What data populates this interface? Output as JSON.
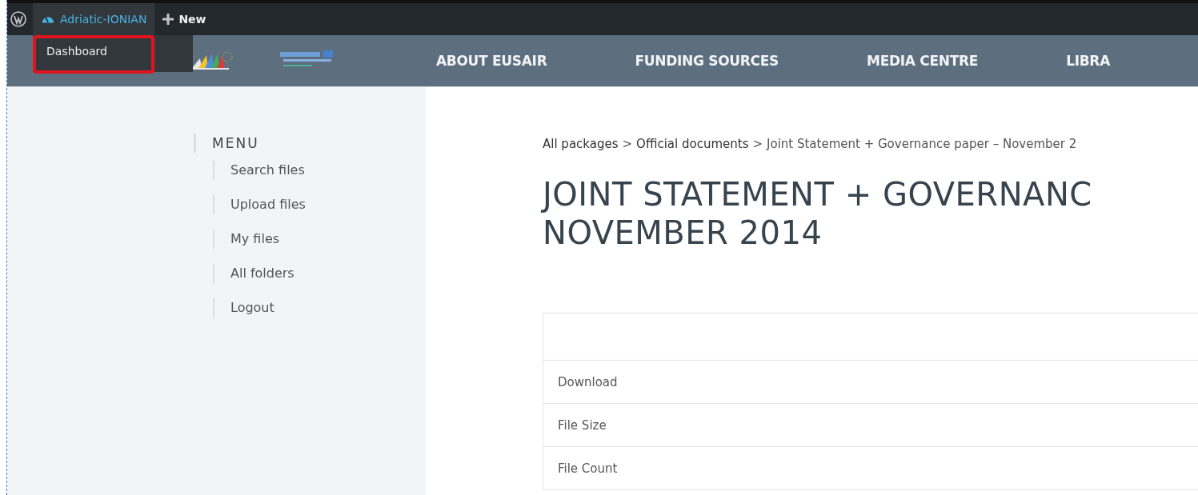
{
  "admin_bar": {
    "site_name": "Adriatic-IONIAN",
    "new_label": "New",
    "dropdown": {
      "items": [
        {
          "label": "Dashboard",
          "highlighted": true
        }
      ]
    }
  },
  "header": {
    "nav": [
      {
        "label": "ABOUT EUSAIR"
      },
      {
        "label": "FUNDING SOURCES"
      },
      {
        "label": "MEDIA CENTRE"
      },
      {
        "label": "LIBRA"
      }
    ]
  },
  "sidebar": {
    "title": "MENU",
    "items": [
      {
        "label": "Search files"
      },
      {
        "label": "Upload files"
      },
      {
        "label": "My files"
      },
      {
        "label": "All folders"
      },
      {
        "label": "Logout"
      }
    ]
  },
  "breadcrumb": [
    {
      "label": "All packages",
      "kind": "link"
    },
    {
      "label": ">",
      "kind": "sep"
    },
    {
      "label": "Official documents",
      "kind": "link"
    },
    {
      "label": ">",
      "kind": "sep"
    },
    {
      "label": "Joint Statement + Governance paper – November 2",
      "kind": "current"
    }
  ],
  "title_lines": [
    "JOINT STATEMENT + GOVERNANC",
    "NOVEMBER 2014"
  ],
  "table": {
    "rows": [
      {
        "label": "Download"
      },
      {
        "label": "File Size"
      },
      {
        "label": "File Count"
      }
    ]
  }
}
